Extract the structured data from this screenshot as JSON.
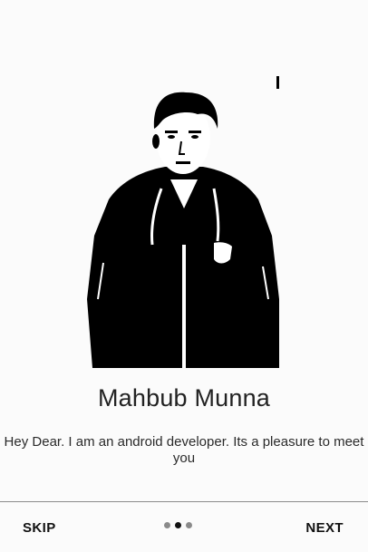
{
  "profile": {
    "name": "Mahbub Munna",
    "bio": "Hey Dear. I am an android developer. Its a pleasure to meet you"
  },
  "navigation": {
    "skip_label": "SKIP",
    "next_label": "NEXT",
    "page_count": 3,
    "active_page": 2
  },
  "colors": {
    "background": "#fbfbfb",
    "text": "#222222",
    "dot_active": "#111111",
    "dot_inactive": "#8a8a8a",
    "divider": "#8c8c8c"
  }
}
